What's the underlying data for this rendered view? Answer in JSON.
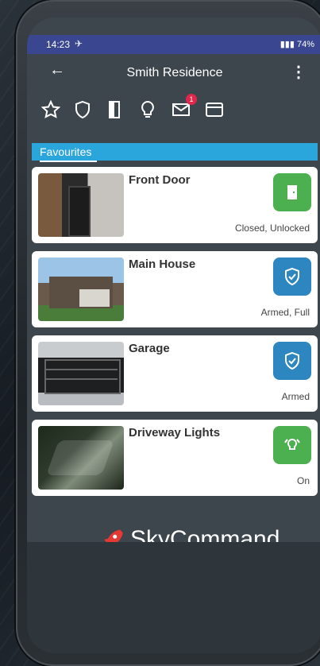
{
  "status_bar": {
    "time": "14:23",
    "battery": "74%"
  },
  "app_bar": {
    "title": "Smith Residence"
  },
  "tabs": [
    {
      "icon": "star-icon"
    },
    {
      "icon": "shield-icon"
    },
    {
      "icon": "door-icon"
    },
    {
      "icon": "bulb-icon"
    },
    {
      "icon": "mail-icon",
      "badge": "1"
    },
    {
      "icon": "web-icon"
    }
  ],
  "section": {
    "label": "Favourites"
  },
  "cards": [
    {
      "name": "Front Door",
      "status": "Closed, Unlocked",
      "status_color": "#4caf50",
      "icon": "door-icon"
    },
    {
      "name": "Main House",
      "status": "Armed, Full",
      "status_color": "#2e86c1",
      "icon": "shield-check-icon"
    },
    {
      "name": "Garage",
      "status": "Armed",
      "status_color": "#2e86c1",
      "icon": "shield-check-icon"
    },
    {
      "name": "Driveway Lights",
      "status": "On",
      "status_color": "#4caf50",
      "icon": "bulb-on-icon"
    }
  ],
  "brand": {
    "name": "SkyCommand"
  },
  "colors": {
    "accent_blue": "#2aa6dd",
    "status_bar": "#3a468f"
  }
}
